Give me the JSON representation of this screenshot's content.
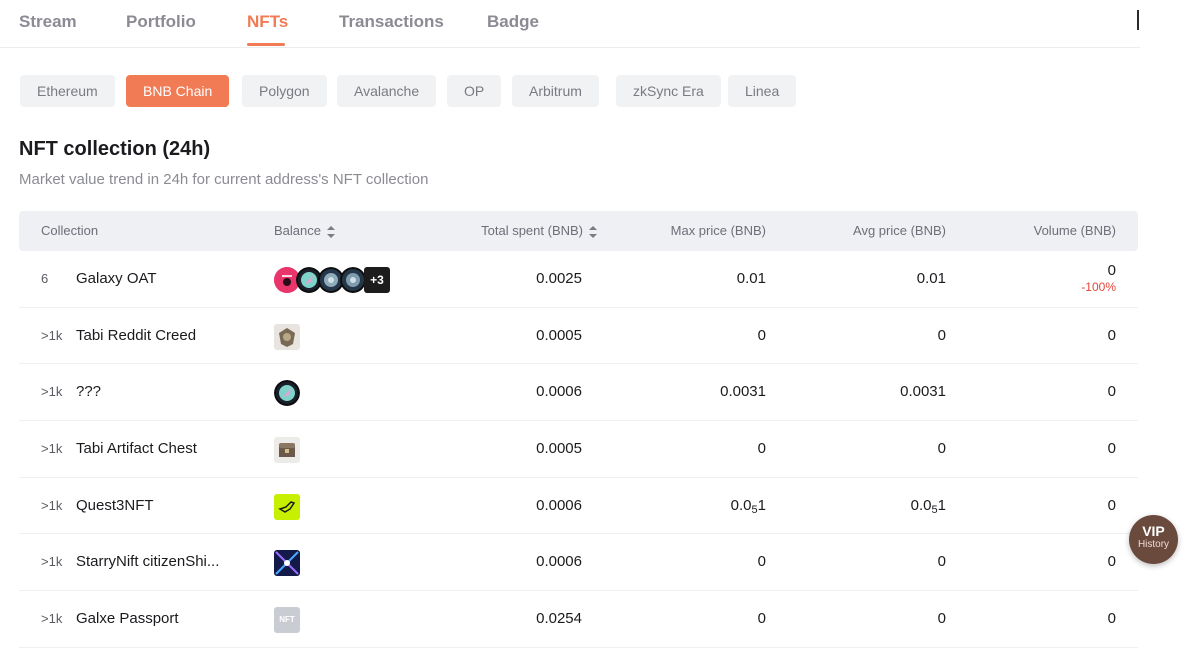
{
  "tabs": [
    {
      "label": "Stream",
      "active": false
    },
    {
      "label": "Portfolio",
      "active": false
    },
    {
      "label": "NFTs",
      "active": true
    },
    {
      "label": "Transactions",
      "active": false
    },
    {
      "label": "Badge",
      "active": false
    }
  ],
  "chains": [
    {
      "label": "Ethereum",
      "active": false
    },
    {
      "label": "BNB Chain",
      "active": true
    },
    {
      "label": "Polygon",
      "active": false
    },
    {
      "label": "Avalanche",
      "active": false
    },
    {
      "label": "OP",
      "active": false
    },
    {
      "label": "Arbitrum",
      "active": false
    },
    {
      "label": "zkSync Era",
      "active": false
    },
    {
      "label": "Linea",
      "active": false
    }
  ],
  "section": {
    "title": "NFT collection (24h)",
    "subtitle": "Market value trend in 24h for current address's NFT collection"
  },
  "table": {
    "headers": {
      "collection": "Collection",
      "balance": "Balance",
      "total_spent": "Total spent (BNB)",
      "max_price": "Max price (BNB)",
      "avg_price": "Avg price (BNB)",
      "volume": "Volume (BNB)"
    },
    "rows": [
      {
        "rank": "6",
        "name": "Galaxy OAT",
        "extra_count": "+3",
        "total_spent": "0.0025",
        "max_price": "0.01",
        "avg_price": "0.01",
        "volume": "0",
        "volume_change": "-100%"
      },
      {
        "rank": ">1k",
        "name": "Tabi Reddit Creed",
        "total_spent": "0.0005",
        "max_price": "0",
        "avg_price": "0",
        "volume": "0"
      },
      {
        "rank": ">1k",
        "name": "???",
        "total_spent": "0.0006",
        "max_price": "0.0031",
        "avg_price": "0.0031",
        "volume": "0"
      },
      {
        "rank": ">1k",
        "name": "Tabi Artifact Chest",
        "total_spent": "0.0005",
        "max_price": "0",
        "avg_price": "0",
        "volume": "0"
      },
      {
        "rank": ">1k",
        "name": "Quest3NFT",
        "total_spent": "0.0006",
        "max_price_main": "0.0",
        "max_price_sub": "5",
        "max_price_tail": "1",
        "avg_price_main": "0.0",
        "avg_price_sub": "5",
        "avg_price_tail": "1",
        "volume": "0"
      },
      {
        "rank": ">1k",
        "name": "StarryNift citizenShi...",
        "total_spent": "0.0006",
        "max_price": "0",
        "avg_price": "0",
        "volume": "0"
      },
      {
        "rank": ">1k",
        "name": "Galxe Passport",
        "thumb_label": "NFT",
        "total_spent": "0.0254",
        "max_price": "0",
        "avg_price": "0",
        "volume": "0"
      }
    ]
  },
  "vip": {
    "label": "VIP",
    "sub": "History"
  },
  "colors": {
    "accent": "#f17b54",
    "negative": "#e4453b"
  }
}
